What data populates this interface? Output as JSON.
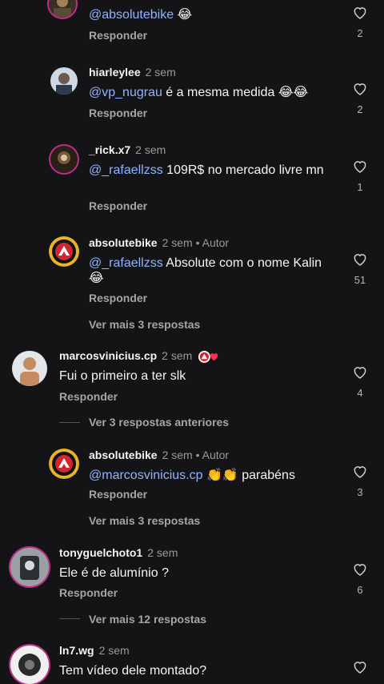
{
  "comments": [
    {
      "username": "",
      "time": "",
      "mention": "@absolutebike",
      "text": " 😂",
      "reply": "Responder",
      "likes": "2"
    },
    {
      "username": "hiarleylee",
      "time": "2 sem",
      "mention": "@vp_nugrau",
      "text": " é a mesma medida 😂😂",
      "reply": "Responder",
      "likes": "2"
    },
    {
      "username": "_rick.x7",
      "time": "2 sem",
      "mention": "@_rafaellzss",
      "text": " 109R$ no mercado livre mn",
      "reply": "Responder",
      "likes": "1"
    },
    {
      "username": "absolutebike",
      "time": "2 sem",
      "author": " • Autor",
      "mention": "@_rafaellzss",
      "text": " Absolute com o nome Kalin 😂",
      "reply": "Responder",
      "likes": "51",
      "more": "Ver mais 3 respostas"
    },
    {
      "username": "marcosvinicius.cp",
      "time": "2 sem",
      "text": "Fui o primeiro a ter slk",
      "reply": "Responder",
      "likes": "4",
      "previous": "Ver 3 respostas anteriores"
    },
    {
      "username": "absolutebike",
      "time": "2 sem",
      "author": " • Autor",
      "mention": "@marcosvinicius.cp",
      "text": " 👏👏 parabéns",
      "reply": "Responder",
      "likes": "3",
      "more": "Ver mais 3 respostas"
    },
    {
      "username": "tonyguelchoto1",
      "time": "2 sem",
      "text": "Ele é de alumínio ?",
      "reply": "Responder",
      "likes": "6",
      "more": "Ver mais 12 respostas"
    },
    {
      "username": "ln7.wg",
      "time": "2 sem",
      "text": "Tem vídeo dele montado?"
    }
  ],
  "icons": {
    "like": "heart-outline-icon"
  },
  "colors": {
    "background": "#141416",
    "mention": "#8fb4ff",
    "secondary": "#a5a5a5"
  }
}
